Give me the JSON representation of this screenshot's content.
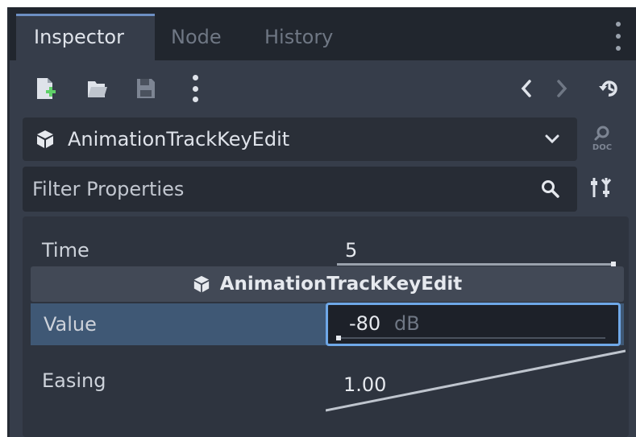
{
  "tabs": [
    {
      "label": "Inspector",
      "active": true
    },
    {
      "label": "Node",
      "active": false
    },
    {
      "label": "History",
      "active": false
    }
  ],
  "toolbar": {
    "icons": [
      "new-resource-icon",
      "open-folder-icon",
      "save-icon",
      "more-options-icon",
      "back-icon",
      "forward-icon",
      "history-icon"
    ]
  },
  "object_selector": {
    "label": "AnimationTrackKeyEdit",
    "icon": "cube-icon"
  },
  "filter": {
    "placeholder": "Filter Properties"
  },
  "properties": {
    "time": {
      "label": "Time",
      "value": "5"
    },
    "section_title": "AnimationTrackKeyEdit",
    "value": {
      "label": "Value",
      "number": "-80",
      "unit": "dB"
    },
    "easing": {
      "label": "Easing",
      "value": "1.00"
    }
  },
  "colors": {
    "panel": "#363d4a",
    "tabbar": "#21262e",
    "accent": "#6fa8e8",
    "selected_row": "#3f5875"
  }
}
